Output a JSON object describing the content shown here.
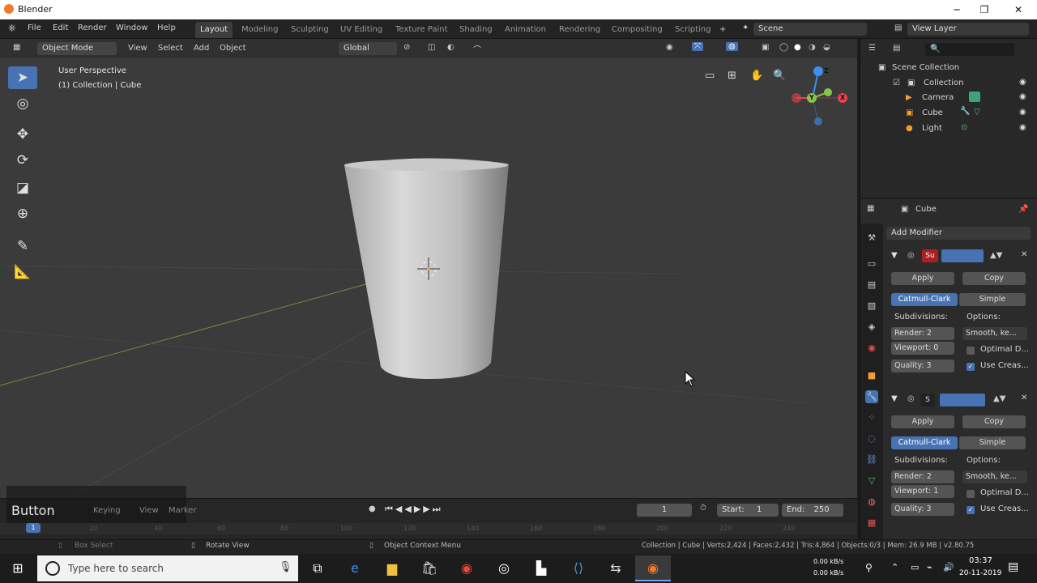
{
  "window": {
    "title": "Blender",
    "minimize": "─",
    "maximize": "❐",
    "close": "✕"
  },
  "menu": [
    "File",
    "Edit",
    "Render",
    "Window",
    "Help"
  ],
  "workspaces": [
    "Layout",
    "Modeling",
    "Sculpting",
    "UV Editing",
    "Texture Paint",
    "Shading",
    "Animation",
    "Rendering",
    "Compositing",
    "Scripting"
  ],
  "workspace_add": "+",
  "scene": {
    "label": "Scene"
  },
  "view_layer": {
    "label": "View Layer"
  },
  "viewport": {
    "mode": "Object Mode",
    "menus": [
      "View",
      "Select",
      "Add",
      "Object"
    ],
    "transform_orientation": "Global",
    "overlay_line1": "User Perspective",
    "overlay_line2": "(1) Collection | Cube",
    "axes": {
      "x": "X",
      "y": "Y",
      "z": "Z"
    }
  },
  "outliner": {
    "root": "Scene Collection",
    "collection": "Collection",
    "items": [
      "Camera",
      "Cube",
      "Light"
    ]
  },
  "properties": {
    "object_name": "Cube",
    "add_modifier": "Add Modifier",
    "modifier1": {
      "name": "Su",
      "apply": "Apply",
      "copy": "Copy",
      "type_a": "Catmull-Clark",
      "type_b": "Simple",
      "subdivisions_label": "Subdivisions:",
      "options_label": "Options:",
      "render": "Render:",
      "render_val": "2",
      "viewport": "Viewport:",
      "viewport_val": "0",
      "quality": "Quality:",
      "quality_val": "3",
      "smooth": "Smooth, ke...",
      "optimal": "Optimal D...",
      "use_crease": "Use Creas..."
    },
    "modifier2": {
      "name": "S",
      "apply": "Apply",
      "copy": "Copy",
      "type_a": "Catmull-Clark",
      "type_b": "Simple",
      "subdivisions_label": "Subdivisions:",
      "options_label": "Options:",
      "render": "Render:",
      "render_val": "2",
      "viewport": "Viewport:",
      "viewport_val": "1",
      "quality": "Quality:",
      "quality_val": "3",
      "smooth": "Smooth, ke...",
      "optimal": "Optimal D...",
      "use_crease": "Use Creas..."
    }
  },
  "timeline": {
    "overlay_title": "Button",
    "menus": [
      "Keying",
      "View",
      "Marker"
    ],
    "current_frame": "1",
    "start_label": "Start:",
    "start": "1",
    "end_label": "End:",
    "end": "250",
    "ruler": [
      "0",
      "20",
      "40",
      "60",
      "80",
      "100",
      "120",
      "140",
      "160",
      "180",
      "200",
      "220",
      "240"
    ]
  },
  "statusbar": {
    "left": "Box Select",
    "mid1": "Rotate View",
    "mid2": "Object Context Menu",
    "right": "Collection | Cube | Verts:2,424 | Faces:2,432 | Tris:4,864 | Objects:0/3 | Mem: 26.9 MB | v2.80.75"
  },
  "taskbar": {
    "search_placeholder": "Type here to search",
    "net_up": "0.00 kB/s",
    "net_down": "0.00 kB/s",
    "time": "03:37",
    "date": "20-11-2019"
  },
  "colors": {
    "accent": "#4772b3",
    "blender_orange": "#f5792a",
    "x_axis": "#e8444e",
    "y_axis": "#8bc34a",
    "z_axis": "#3d8ff0"
  }
}
